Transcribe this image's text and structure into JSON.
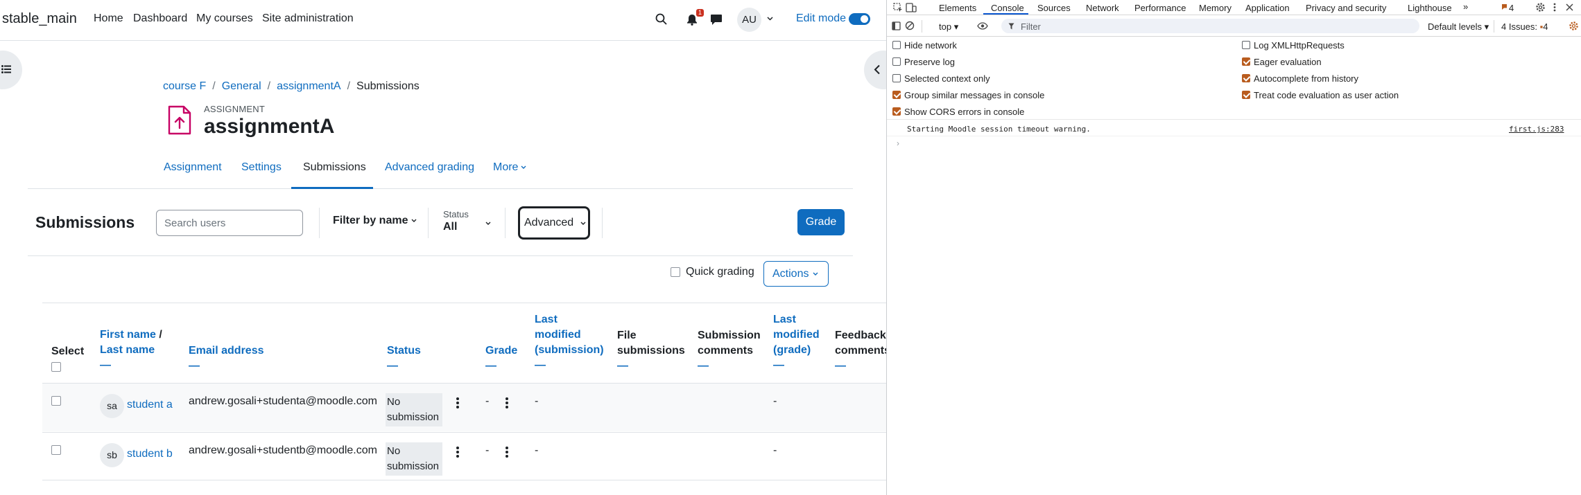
{
  "navbar": {
    "site_name": "stable_main",
    "links": [
      "Home",
      "Dashboard",
      "My courses",
      "Site administration"
    ],
    "notification_count": "1",
    "user_initials": "AU",
    "edit_mode_label": "Edit mode",
    "edit_mode_on": true
  },
  "breadcrumb": [
    "course F",
    "General",
    "assignmentA",
    "Submissions"
  ],
  "header": {
    "activity_type": "ASSIGNMENT",
    "title": "assignmentA"
  },
  "tabs": [
    {
      "label": "Assignment",
      "active": false
    },
    {
      "label": "Settings",
      "active": false
    },
    {
      "label": "Submissions",
      "active": true
    },
    {
      "label": "Advanced grading",
      "active": false
    },
    {
      "label": "More",
      "active": false
    }
  ],
  "controls": {
    "heading": "Submissions",
    "search_placeholder": "Search users",
    "filter_by_name": "Filter by name",
    "status_label": "Status",
    "status_value": "All",
    "advanced_label": "Advanced",
    "grade_button": "Grade",
    "quick_grading_label": "Quick grading",
    "actions_button": "Actions"
  },
  "table": {
    "headers": {
      "select": "Select",
      "first_name": "First name",
      "slash": " /",
      "last_name": "Last name",
      "email": "Email address",
      "status": "Status",
      "grade": "Grade",
      "last_modified_sub": [
        "Last",
        "modified",
        "(submission)"
      ],
      "file_submissions": [
        "File",
        "submissions"
      ],
      "submission_comments": [
        "Submission",
        "comments"
      ],
      "last_modified_grade": [
        "Last",
        "modified",
        "(grade)"
      ],
      "feedback_comments": [
        "Feedback",
        "comments"
      ],
      "sort_dash": "—"
    },
    "rows": [
      {
        "initials": "sa",
        "name": "student a",
        "email": "andrew.gosali+studenta@moodle.com",
        "status_line1": "No",
        "status_line2": "submission",
        "grade": "-",
        "last_modified_sub": "-",
        "last_modified_grade": "-"
      },
      {
        "initials": "sb",
        "name": "student b",
        "email": "andrew.gosali+studentb@moodle.com",
        "status_line1": "No",
        "status_line2": "submission",
        "grade": "-",
        "last_modified_sub": "-",
        "last_modified_grade": "-"
      }
    ]
  },
  "devtools": {
    "tabs": [
      "Elements",
      "Console",
      "Sources",
      "Network",
      "Performance",
      "Memory",
      "Application",
      "Privacy and security",
      "Lighthouse"
    ],
    "active_tab": "Console",
    "badge_count": "4",
    "context": "top",
    "filter_placeholder": "Filter",
    "levels": "Default levels",
    "issues_label": "4 Issues:",
    "issues_count": "4",
    "options_left": [
      {
        "label": "Hide network",
        "checked": false
      },
      {
        "label": "Preserve log",
        "checked": false
      },
      {
        "label": "Selected context only",
        "checked": false
      },
      {
        "label": "Group similar messages in console",
        "checked": true
      },
      {
        "label": "Show CORS errors in console",
        "checked": true
      }
    ],
    "options_right": [
      {
        "label": "Log XMLHttpRequests",
        "checked": false
      },
      {
        "label": "Eager evaluation",
        "checked": true
      },
      {
        "label": "Autocomplete from history",
        "checked": true
      },
      {
        "label": "Treat code evaluation as user action",
        "checked": true
      }
    ],
    "message": "Starting Moodle session timeout warning.",
    "message_source": "first.js:283",
    "prompt": "›"
  },
  "colors": {
    "brand": "#0f6cbf",
    "assignment_icon": "#c70064",
    "devtools_accent": "#b95c1e"
  }
}
